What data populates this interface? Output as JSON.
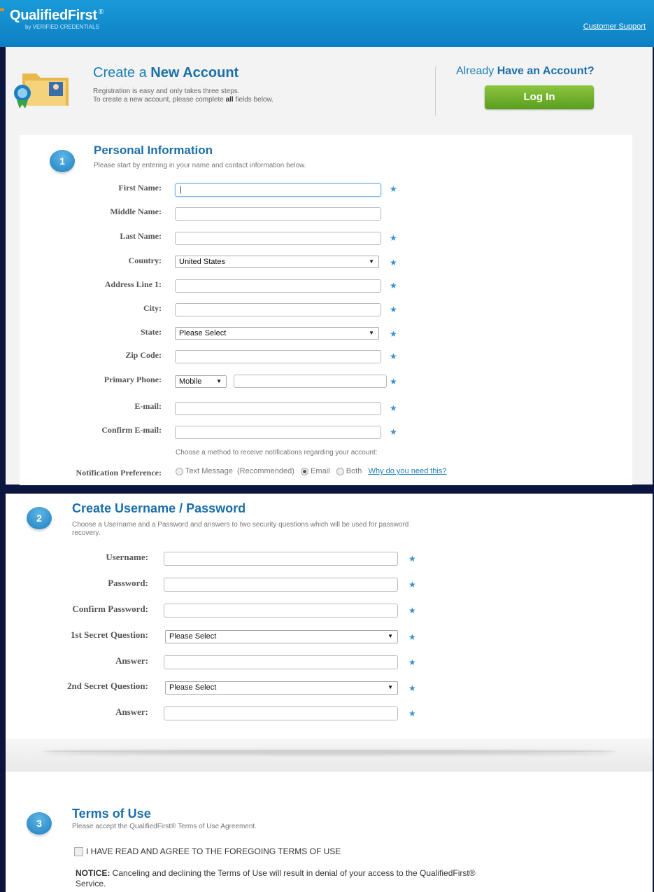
{
  "header": {
    "logo": "QualifiedFirst",
    "logo_reg": "®",
    "logo_sub": "by VERIFIED CREDENTIALS",
    "support_link": "Customer Support"
  },
  "intro": {
    "title_pre": "Create a ",
    "title_bold": "New Account",
    "sub1": "Registration is easy and only takes three steps.",
    "sub2_pre": "To create a new account, please complete ",
    "sub2_bold": "all",
    "sub2_post": " fields below.",
    "already_pre": "Already ",
    "already_bold": "Have an Account?",
    "login_button": "Log In"
  },
  "section1": {
    "number": "1",
    "title": "Personal Information",
    "subtitle": "Please start by entering in your name and contact information below.",
    "labels": {
      "first": "First Name:",
      "middle": "Middle Name:",
      "last": "Last Name:",
      "country": "Country:",
      "address": "Address Line 1:",
      "city": "City:",
      "state": "State:",
      "zip": "Zip Code:",
      "phone": "Primary Phone:",
      "email": "E-mail:",
      "confirm_email": "Confirm E-mail:"
    },
    "values": {
      "first": "|",
      "country": "United States",
      "state": "Please Select",
      "phone_type": "Mobile"
    },
    "notify_hint": "Choose a method to receive notifications regarding your account:",
    "notify_label": "Notification Preference:",
    "notify_options": [
      "Text Message  (Recommended)",
      "Email",
      "Both"
    ],
    "notify_selected": "Email",
    "why_link": "Why do you need this?"
  },
  "section2": {
    "number": "2",
    "title": "Create Username / Password",
    "subtitle1": "Choose a Username and a Password and answers to two security questions which will be used for password",
    "subtitle2": "recovery.",
    "labels": {
      "username": "Username:",
      "password": "Password:",
      "confirm_password": "Confirm Password:",
      "q1": "1st Secret Question:",
      "a1": "Answer:",
      "q2": "2nd Secret Question:",
      "a2": "Answer:"
    },
    "values": {
      "q1": "Please Select",
      "q2": "Please Select"
    }
  },
  "section3": {
    "number": "3",
    "title": "Terms of Use",
    "subtitle": "Please accept the QualifiedFirst® Terms of Use Agreement.",
    "agree": "I HAVE READ AND AGREE TO THE FOREGOING TERMS OF USE",
    "notice_label": "NOTICE:",
    "notice1": " Canceling and declining the Terms of Use will result in denial of your access to the QualifiedFirst®",
    "notice2": "Service."
  },
  "icons": {
    "required": "star-icon",
    "dropdown": "triangle-down-icon"
  },
  "colors": {
    "header": "#1a9ad8",
    "accent": "#1b7fb6",
    "login": "#6aaf2a"
  }
}
